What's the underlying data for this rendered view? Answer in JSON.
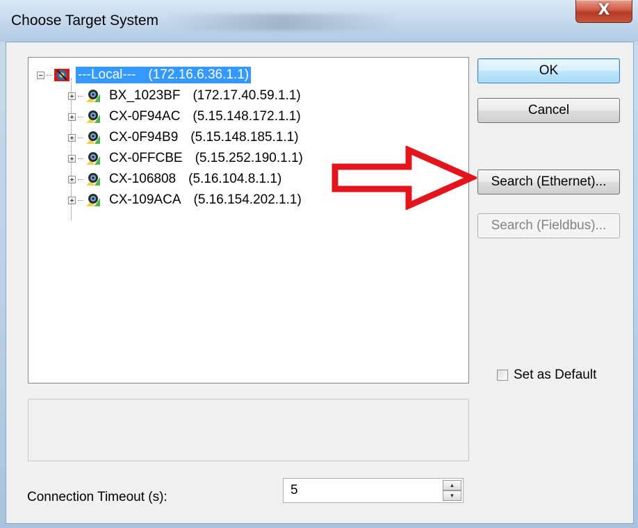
{
  "window": {
    "title": "Choose Target System",
    "close_glyph": "X"
  },
  "tree": {
    "root": {
      "name": "---Local---",
      "address": "(172.16.6.36.1.1)"
    },
    "children": [
      {
        "name": "BX_1023BF",
        "address": "(172.17.40.59.1.1)"
      },
      {
        "name": "CX-0F94AC",
        "address": "(5.15.148.172.1.1)"
      },
      {
        "name": "CX-0F94B9",
        "address": "(5.15.148.185.1.1)"
      },
      {
        "name": "CX-0FFCBE",
        "address": "(5.15.252.190.1.1)"
      },
      {
        "name": "CX-106808",
        "address": "(5.16.104.8.1.1)"
      },
      {
        "name": "CX-109ACA",
        "address": "(5.16.154.202.1.1)"
      }
    ]
  },
  "buttons": {
    "ok": "OK",
    "cancel": "Cancel",
    "search_ethernet": "Search (Ethernet)...",
    "search_fieldbus": "Search (Fieldbus)..."
  },
  "options": {
    "set_as_default": "Set as Default"
  },
  "timeout": {
    "label": "Connection Timeout (s):",
    "value": "5"
  },
  "colors": {
    "selection": "#3399ff",
    "annotation_arrow": "#e3141b"
  }
}
